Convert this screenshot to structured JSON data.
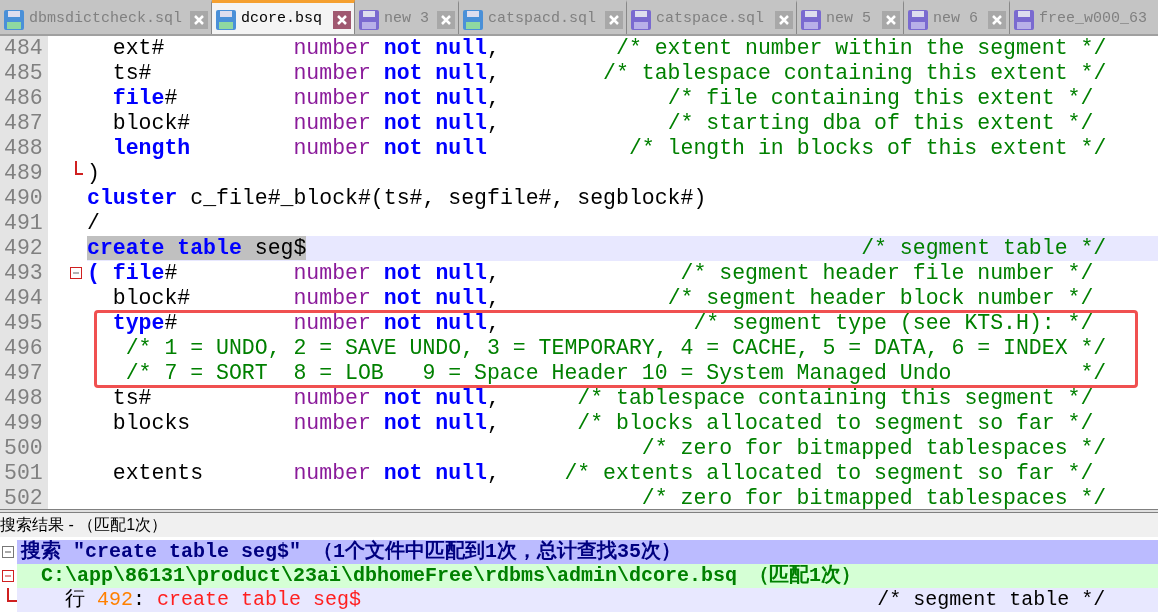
{
  "tabs": [
    {
      "label": "dbmsdictcheck.sql",
      "selected": false,
      "saved": true
    },
    {
      "label": "dcore.bsq",
      "selected": true,
      "saved": true
    },
    {
      "label": "new 3",
      "selected": false,
      "saved": false
    },
    {
      "label": "catspacd.sql",
      "selected": false,
      "saved": true
    },
    {
      "label": "catspace.sql",
      "selected": false,
      "saved": false
    },
    {
      "label": "new 5",
      "selected": false,
      "saved": false
    },
    {
      "label": "new 6",
      "selected": false,
      "saved": false
    },
    {
      "label": "free_w000_63",
      "selected": false,
      "saved": false
    }
  ],
  "editor": {
    "lines": [
      {
        "number": "484",
        "current": false,
        "fold_start": false,
        "fold_end": false,
        "tokens": [
          {
            "kind": "plain",
            "text": "  ext#          "
          },
          {
            "kind": "type",
            "text": "number "
          },
          {
            "kind": "keyword",
            "text": "not null"
          },
          {
            "kind": "plain",
            "text": ",         "
          },
          {
            "kind": "comment",
            "text": "/* extent number within the segment */"
          }
        ]
      },
      {
        "number": "485",
        "current": false,
        "fold_start": false,
        "fold_end": false,
        "tokens": [
          {
            "kind": "plain",
            "text": "  ts#           "
          },
          {
            "kind": "type",
            "text": "number "
          },
          {
            "kind": "keyword",
            "text": "not null"
          },
          {
            "kind": "plain",
            "text": ",        "
          },
          {
            "kind": "comment",
            "text": "/* tablespace containing this extent */"
          }
        ]
      },
      {
        "number": "486",
        "current": false,
        "fold_start": false,
        "fold_end": false,
        "tokens": [
          {
            "kind": "keyword",
            "text": "  file"
          },
          {
            "kind": "plain",
            "text": "#         "
          },
          {
            "kind": "type",
            "text": "number "
          },
          {
            "kind": "keyword",
            "text": "not null"
          },
          {
            "kind": "plain",
            "text": ",             "
          },
          {
            "kind": "comment",
            "text": "/* file containing this extent */"
          }
        ]
      },
      {
        "number": "487",
        "current": false,
        "fold_start": false,
        "fold_end": false,
        "tokens": [
          {
            "kind": "plain",
            "text": "  block#        "
          },
          {
            "kind": "type",
            "text": "number "
          },
          {
            "kind": "keyword",
            "text": "not null"
          },
          {
            "kind": "plain",
            "text": ",             "
          },
          {
            "kind": "comment",
            "text": "/* starting dba of this extent */"
          }
        ]
      },
      {
        "number": "488",
        "current": false,
        "fold_start": false,
        "fold_end": false,
        "tokens": [
          {
            "kind": "keyword",
            "text": "  length"
          },
          {
            "kind": "type",
            "text": "        number "
          },
          {
            "kind": "keyword",
            "text": "not null"
          },
          {
            "kind": "comment",
            "text": "           /* length in blocks of this extent */"
          }
        ]
      },
      {
        "number": "489",
        "current": false,
        "fold_start": false,
        "fold_end": true,
        "tokens": [
          {
            "kind": "plain",
            "text": ")"
          }
        ]
      },
      {
        "number": "490",
        "current": false,
        "fold_start": false,
        "fold_end": false,
        "tokens": [
          {
            "kind": "keyword",
            "text": "cluster"
          },
          {
            "kind": "plain",
            "text": " c_file#_block#(ts#, segfile#, segblock#)"
          }
        ]
      },
      {
        "number": "491",
        "current": false,
        "fold_start": false,
        "fold_end": false,
        "tokens": [
          {
            "kind": "plain",
            "text": "/"
          }
        ]
      },
      {
        "number": "492",
        "current": true,
        "fold_start": false,
        "fold_end": false,
        "tokens": [
          {
            "kind": "keyword",
            "text": "create table",
            "marked": true
          },
          {
            "kind": "plain",
            "text": " seg$",
            "marked": true
          },
          {
            "kind": "comment",
            "text": "                                           /* segment table */"
          }
        ]
      },
      {
        "number": "493",
        "current": false,
        "fold_start": true,
        "fold_end": false,
        "tokens": [
          {
            "kind": "keyword",
            "text": "( file"
          },
          {
            "kind": "plain",
            "text": "#         "
          },
          {
            "kind": "type",
            "text": "number "
          },
          {
            "kind": "keyword",
            "text": "not null"
          },
          {
            "kind": "plain",
            "text": ",              "
          },
          {
            "kind": "comment",
            "text": "/* segment header file number */"
          }
        ]
      },
      {
        "number": "494",
        "current": false,
        "fold_start": false,
        "fold_end": false,
        "tokens": [
          {
            "kind": "plain",
            "text": "  block#        "
          },
          {
            "kind": "type",
            "text": "number "
          },
          {
            "kind": "keyword",
            "text": "not null"
          },
          {
            "kind": "plain",
            "text": ",             "
          },
          {
            "kind": "comment",
            "text": "/* segment header block number */"
          }
        ]
      },
      {
        "number": "495",
        "current": false,
        "fold_start": false,
        "fold_end": false,
        "tokens": [
          {
            "kind": "keyword",
            "text": "  type"
          },
          {
            "kind": "plain",
            "text": "#         "
          },
          {
            "kind": "type",
            "text": "number "
          },
          {
            "kind": "keyword",
            "text": "not null"
          },
          {
            "kind": "plain",
            "text": ",               "
          },
          {
            "kind": "comment",
            "text": "/* segment type (see KTS.H): */"
          }
        ]
      },
      {
        "number": "496",
        "current": false,
        "fold_start": false,
        "fold_end": false,
        "tokens": [
          {
            "kind": "comment",
            "text": "   /* 1 = UNDO, 2 = SAVE UNDO, 3 = TEMPORARY, 4 = CACHE, 5 = DATA, 6 = INDEX */"
          }
        ]
      },
      {
        "number": "497",
        "current": false,
        "fold_start": false,
        "fold_end": false,
        "tokens": [
          {
            "kind": "comment",
            "text": "   /* 7 = SORT  8 = LOB   9 = Space Header 10 = System Managed Undo          */"
          }
        ]
      },
      {
        "number": "498",
        "current": false,
        "fold_start": false,
        "fold_end": false,
        "tokens": [
          {
            "kind": "plain",
            "text": "  ts#           "
          },
          {
            "kind": "type",
            "text": "number "
          },
          {
            "kind": "keyword",
            "text": "not null"
          },
          {
            "kind": "plain",
            "text": ",      "
          },
          {
            "kind": "comment",
            "text": "/* tablespace containing this segment */"
          }
        ]
      },
      {
        "number": "499",
        "current": false,
        "fold_start": false,
        "fold_end": false,
        "tokens": [
          {
            "kind": "plain",
            "text": "  blocks        "
          },
          {
            "kind": "type",
            "text": "number "
          },
          {
            "kind": "keyword",
            "text": "not null"
          },
          {
            "kind": "plain",
            "text": ",      "
          },
          {
            "kind": "comment",
            "text": "/* blocks allocated to segment so far */"
          }
        ]
      },
      {
        "number": "500",
        "current": false,
        "fold_start": false,
        "fold_end": false,
        "tokens": [
          {
            "kind": "comment",
            "text": "                                           /* zero for bitmapped tablespaces */"
          }
        ]
      },
      {
        "number": "501",
        "current": false,
        "fold_start": false,
        "fold_end": false,
        "tokens": [
          {
            "kind": "plain",
            "text": "  extents       "
          },
          {
            "kind": "type",
            "text": "number "
          },
          {
            "kind": "keyword",
            "text": "not null"
          },
          {
            "kind": "plain",
            "text": ",     "
          },
          {
            "kind": "comment",
            "text": "/* extents allocated to segment so far */"
          }
        ]
      },
      {
        "number": "502",
        "current": false,
        "fold_start": false,
        "fold_end": false,
        "tokens": [
          {
            "kind": "comment",
            "text": "                                           /* zero for bitmapped tablespaces */"
          }
        ]
      }
    ]
  },
  "search_results": {
    "title": "搜索结果 - （匹配1次）",
    "rows": [
      {
        "kind": "search",
        "text": "搜索 \"create table seg$\" （1个文件中匹配到1次，总计查找35次）"
      },
      {
        "kind": "file",
        "text": "C:\\app\\86131\\product\\23ai\\dbhomeFree\\rdbms\\admin\\dcore.bsq （匹配1次）"
      },
      {
        "kind": "hit",
        "label": "行",
        "line": "492",
        "separator": ":",
        "match": "create table seg$",
        "rest": "                                           /* segment table */"
      }
    ]
  }
}
